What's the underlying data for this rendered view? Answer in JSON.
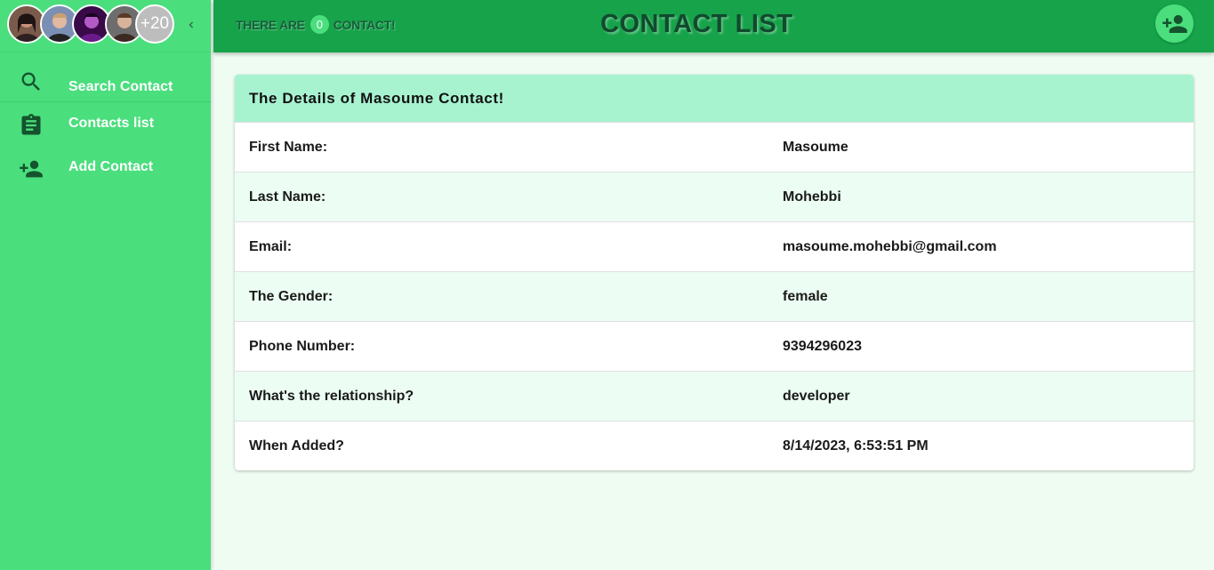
{
  "sidebar": {
    "avatars_more": "+20",
    "items": [
      {
        "label": "Search Contact",
        "icon": "search-icon"
      },
      {
        "label": "Contacts list",
        "icon": "clipboard-icon"
      },
      {
        "label": "Add Contact",
        "icon": "person-add-icon"
      }
    ]
  },
  "header": {
    "count_prefix": "THERE ARE",
    "count": "0",
    "count_suffix": "CONTACT!",
    "title": "CONTACT LIST"
  },
  "details": {
    "title": "The Details of Masoume Contact!",
    "rows": [
      {
        "label": "First Name:",
        "value": "Masoume"
      },
      {
        "label": "Last Name:",
        "value": "Mohebbi"
      },
      {
        "label": "Email:",
        "value": "masoume.mohebbi@gmail.com"
      },
      {
        "label": "The Gender:",
        "value": "female"
      },
      {
        "label": "Phone Number:",
        "value": "9394296023"
      },
      {
        "label": "What's the relationship?",
        "value": "developer"
      },
      {
        "label": "When Added?",
        "value": "8/14/2023, 6:53:51 PM"
      }
    ]
  },
  "colors": {
    "sidebar": "#4ade7d",
    "header": "#16a34a",
    "card_header": "#a7f3d0",
    "row_alt": "#ecfdf3",
    "background": "#eefcf2"
  }
}
